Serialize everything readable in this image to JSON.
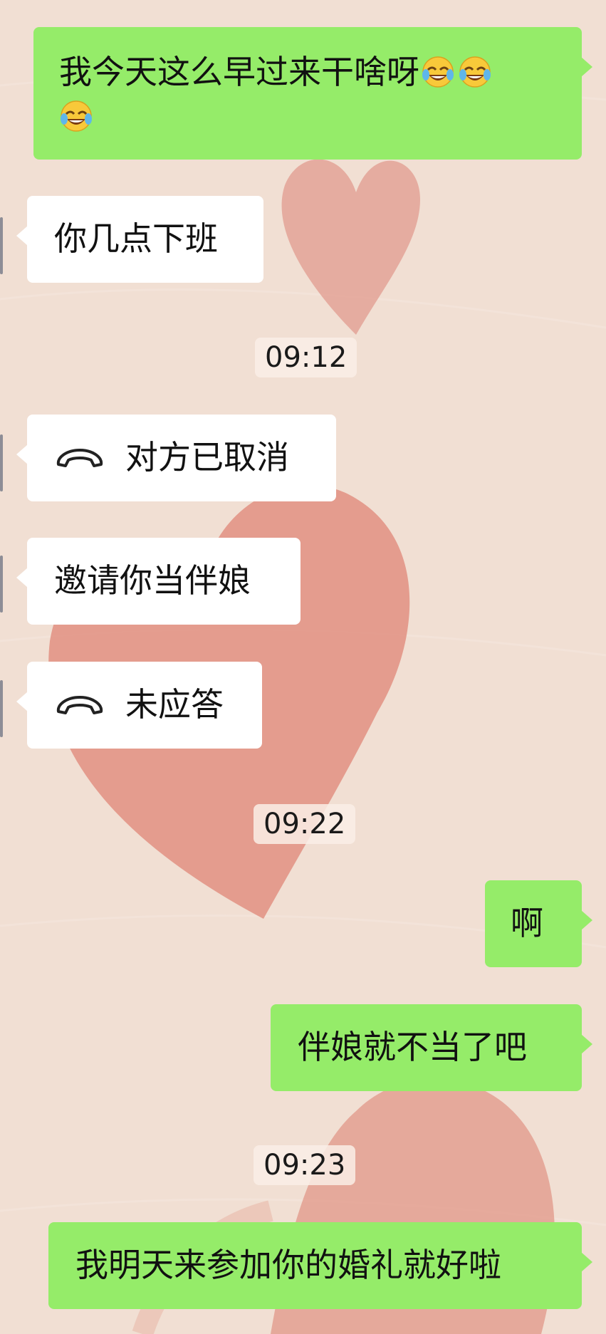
{
  "colors": {
    "background": "#f1dfd3",
    "heart": "#e0978a",
    "incoming_bubble": "#ffffff",
    "outgoing_bubble": "#95ec69"
  },
  "messages": [
    {
      "side": "right",
      "text": "我今天这么早过来干啥呀",
      "emoji": [
        "face-with-tears-of-joy-emoji",
        "face-with-tears-of-joy-emoji",
        "face-with-tears-of-joy-emoji"
      ]
    },
    {
      "side": "left",
      "text": "你几点下班"
    },
    {
      "type": "timestamp",
      "text": "09:12"
    },
    {
      "side": "left",
      "icon": "phone-hangup-icon",
      "text": "对方已取消"
    },
    {
      "side": "left",
      "text": "邀请你当伴娘"
    },
    {
      "side": "left",
      "icon": "phone-hangup-icon",
      "text": "未应答"
    },
    {
      "type": "timestamp",
      "text": "09:22"
    },
    {
      "side": "right",
      "text": "啊"
    },
    {
      "side": "right",
      "text": "伴娘就不当了吧"
    },
    {
      "type": "timestamp",
      "text": "09:23"
    },
    {
      "side": "right",
      "text": "我明天来参加你的婚礼就好啦"
    }
  ]
}
